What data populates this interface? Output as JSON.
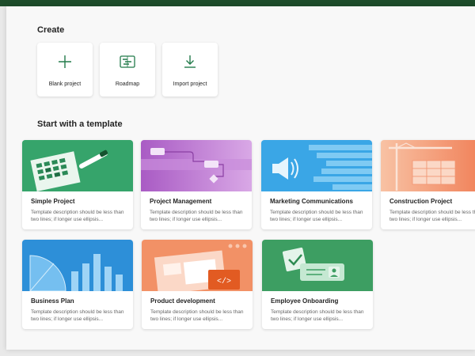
{
  "create": {
    "heading": "Create",
    "tiles": [
      {
        "label": "Blank project",
        "icon": "plus-icon"
      },
      {
        "label": "Roadmap",
        "icon": "roadmap-icon"
      },
      {
        "label": "Import project",
        "icon": "download-icon"
      }
    ]
  },
  "templates": {
    "heading": "Start with a template",
    "cards": [
      {
        "title": "Simple Project",
        "description": "Template description should be less than two lines; if longer use ellipsis..."
      },
      {
        "title": "Project Management",
        "description": "Template description should be less than two lines; if longer use ellipsis..."
      },
      {
        "title": "Marketing Communications",
        "description": "Template description should be less than two lines; if longer use ellipsis..."
      },
      {
        "title": "Construction Project",
        "description": "Template description should be less than two lines; if longer use ellipsis..."
      },
      {
        "title": "Business Plan",
        "description": "Template description should be less than two lines; if longer use ellipsis..."
      },
      {
        "title": "Product development",
        "description": "Template description should be less than two lines; if longer use ellipsis..."
      },
      {
        "title": "Employee Onboarding",
        "description": "Template description should be less than two lines; if longer use ellipsis..."
      }
    ]
  },
  "colors": {
    "brand_green": "#1e4d2b",
    "icon_green": "#237b4b"
  }
}
